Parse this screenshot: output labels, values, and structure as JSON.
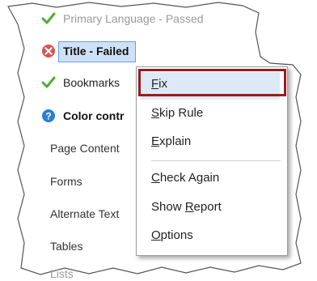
{
  "checker": {
    "items": [
      {
        "status": "passed",
        "label": "Primary Language - Passed"
      },
      {
        "status": "failed",
        "label": "Title - Failed"
      },
      {
        "status": "passed",
        "label": "Bookmarks"
      },
      {
        "status": "info",
        "label": "Color contr"
      }
    ],
    "sub_items": [
      "Page Content",
      "Forms",
      "Alternate Text",
      "Tables",
      "Lists"
    ]
  },
  "context_menu": {
    "fix": {
      "prefix": "",
      "mnemonic": "F",
      "rest": "ix"
    },
    "skip_rule": {
      "prefix": "",
      "mnemonic": "S",
      "rest": "kip Rule"
    },
    "explain": {
      "prefix": "",
      "mnemonic": "E",
      "rest": "xplain"
    },
    "check_again": {
      "prefix": "",
      "mnemonic": "C",
      "rest": "heck Again"
    },
    "show_report": {
      "prefix": "Show ",
      "mnemonic": "R",
      "rest": "eport"
    },
    "options": {
      "prefix": "",
      "mnemonic": "O",
      "rest": "ptions"
    }
  },
  "colors": {
    "passed": "#4caf2f",
    "failed": "#d9534f",
    "info": "#2a7fd4",
    "highlight_border": "#9b1b1e",
    "selection": "#cfe1f6"
  },
  "icons": {
    "passed": "check-icon",
    "failed": "error-icon",
    "info": "info-icon"
  }
}
